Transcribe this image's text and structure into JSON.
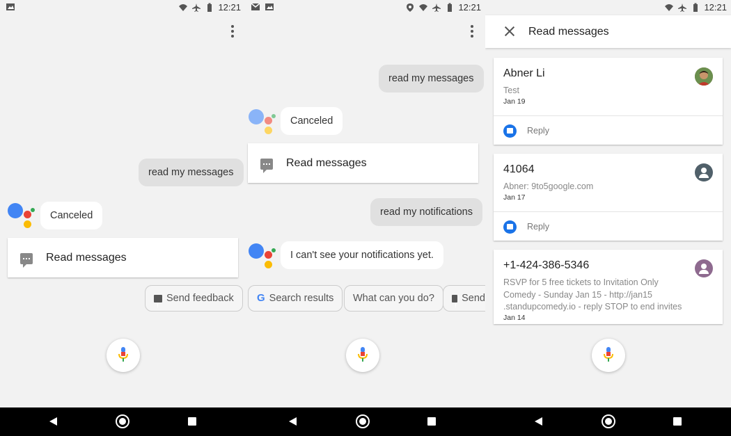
{
  "status": {
    "time": "12:21"
  },
  "colors": {
    "google_blue": "#4285f4",
    "google_red": "#ea4335",
    "google_yellow": "#fbbc05",
    "google_green": "#34a853"
  },
  "screen1": {
    "user_query": "read my messages",
    "assistant_reply": "Canceled",
    "card_label": "Read messages",
    "chip_feedback": "Send feedback"
  },
  "screen2": {
    "user_query_1": "read my messages",
    "assistant_reply_1": "Canceled",
    "card_label": "Read messages",
    "user_query_2": "read my notifications",
    "assistant_reply_2": "I can't see your notifications yet.",
    "chips": [
      "Search results",
      "What can you do?",
      "Send"
    ]
  },
  "screen3": {
    "title": "Read messages",
    "messages": [
      {
        "sender": "Abner Li",
        "preview": "Test",
        "date": "Jan 19",
        "reply": "Reply",
        "avatar": "photo"
      },
      {
        "sender": "41064",
        "preview": "Abner: 9to5google.com",
        "date": "Jan 17",
        "reply": "Reply",
        "avatar": "person-icon"
      },
      {
        "sender": "+1-424-386-5346",
        "preview_lines": [
          "RSVP for 5 free tickets to Invitation Only",
          "Comedy - Sunday Jan 15 - http://jan15",
          ".standupcomedy.io - reply STOP to end invites"
        ],
        "date": "Jan 14",
        "avatar": "person-icon"
      }
    ],
    "avatar_colors": [
      "#50606a",
      "#8e6a8f"
    ]
  }
}
